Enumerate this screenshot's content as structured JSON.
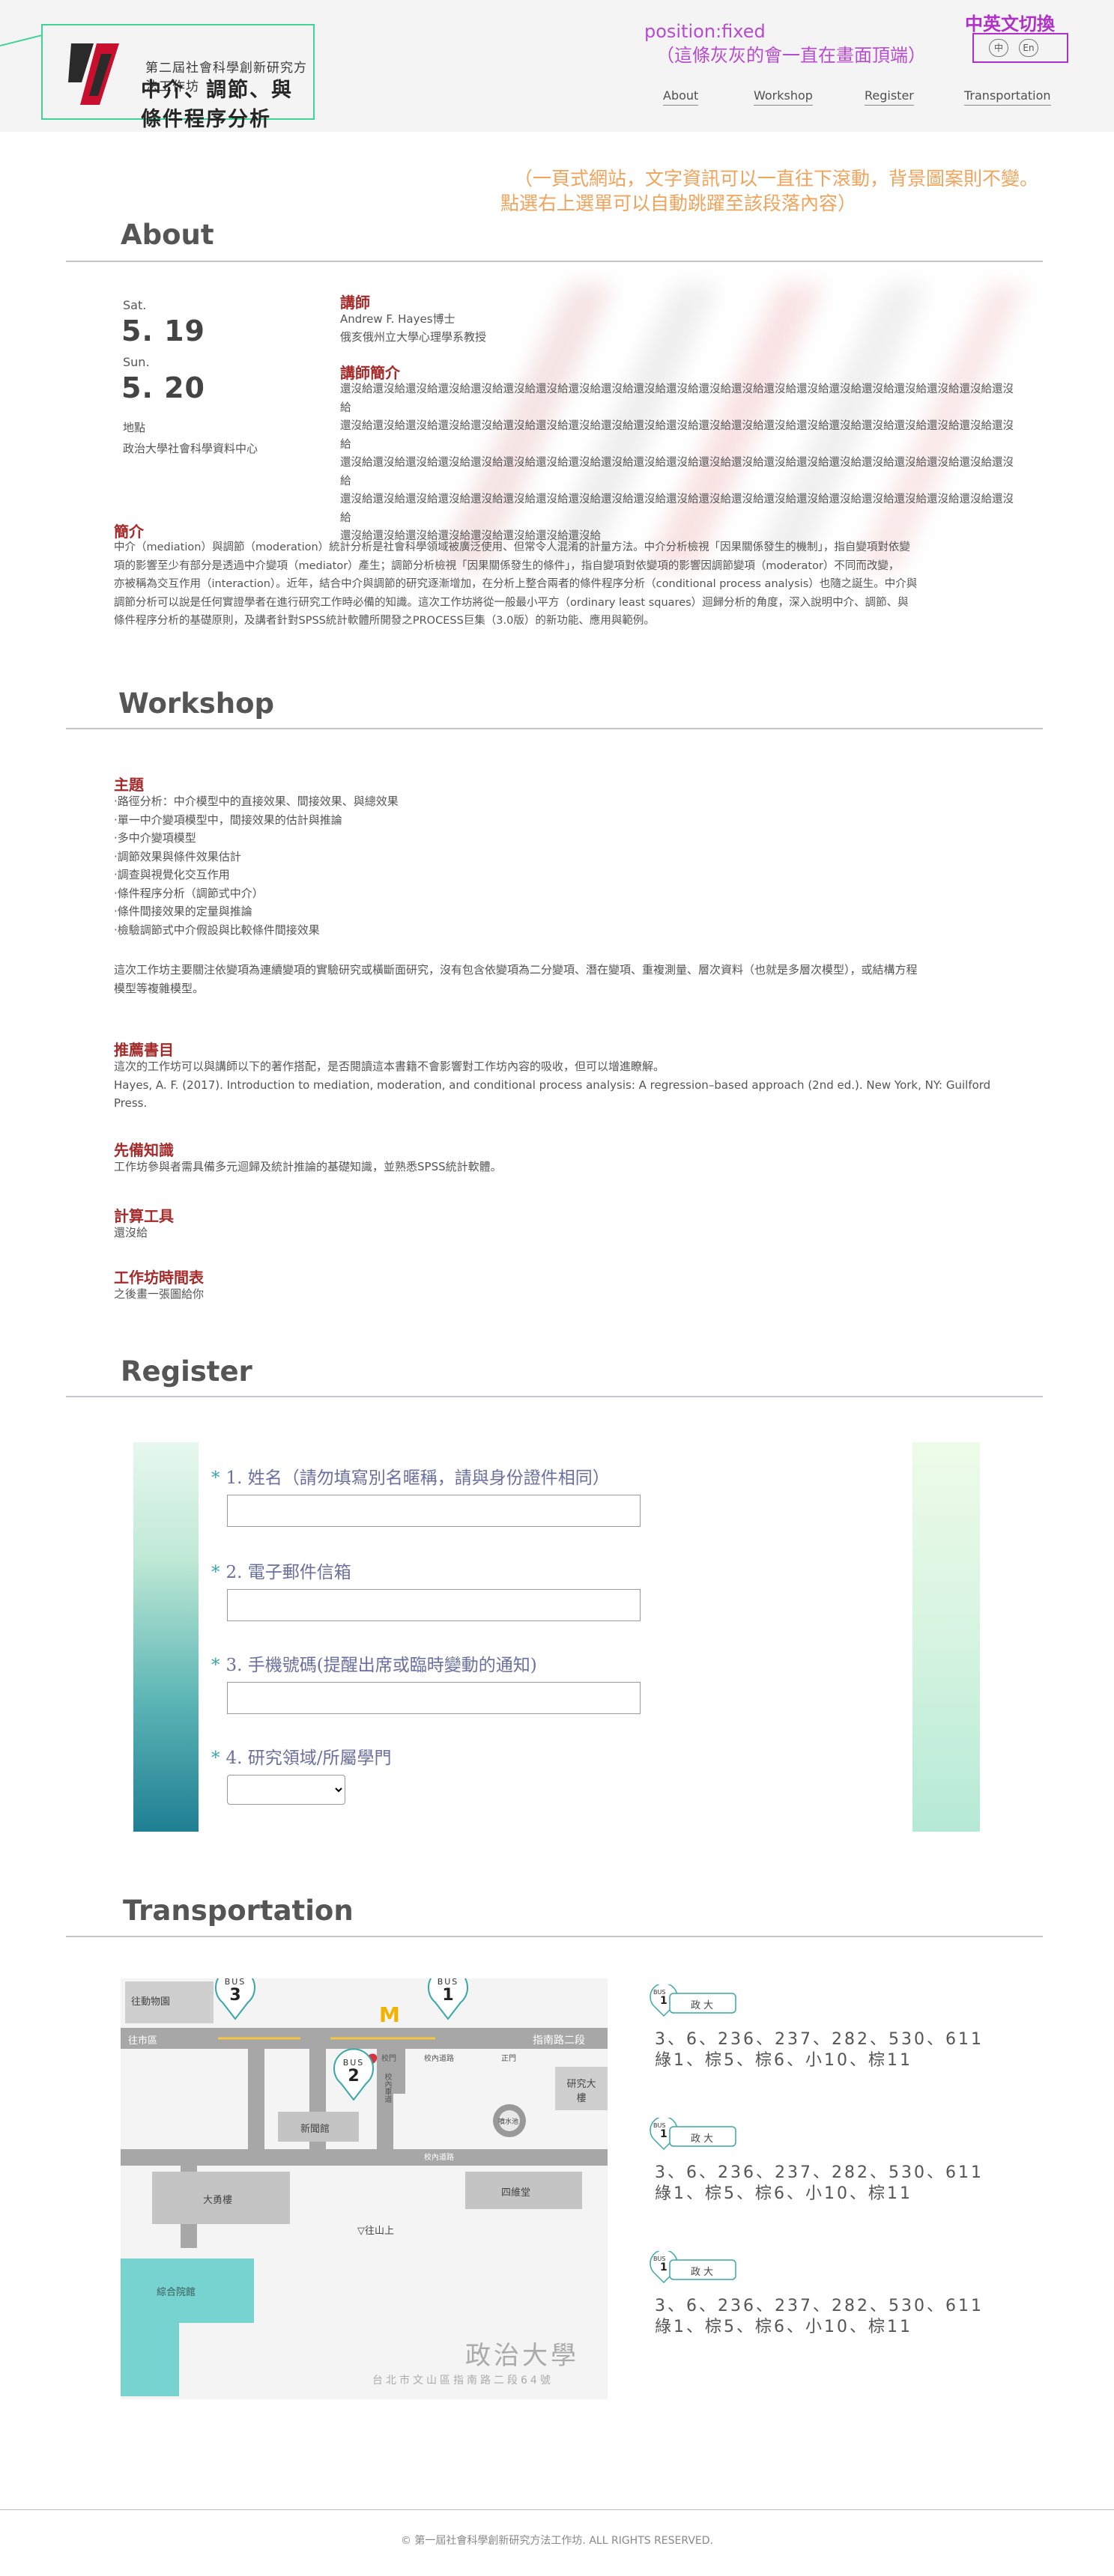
{
  "header": {
    "subtitle": "第二屆社會科學創新研究方法工作坊",
    "title": "中介、調節、與條件程序分析",
    "annotation_line1": "position:fixed",
    "annotation_line2": "（這條灰灰的會一直在畫面頂端）",
    "lang_title": "中英文切換",
    "lang_zh": "中",
    "lang_en": "En",
    "nav": [
      "About",
      "Workshop",
      "Register",
      "Transportation"
    ]
  },
  "annotation_scroll": {
    "line1": "（一頁式網站，文字資訊可以一直往下滾動，背景圖案則不變。",
    "line2": "點選右上選單可以自動跳躍至該段落內容）"
  },
  "about": {
    "title": "About",
    "day1_label": "Sat.",
    "day1_date": "5. 19",
    "day2_label": "Sun.",
    "day2_date": "5. 20",
    "venue_label": "地點",
    "venue": "政治大學社會科學資料中心",
    "lecturer_heading": "講師",
    "lecturer_name": "Andrew F. Hayes博士",
    "lecturer_affil": "俄亥俄州立大學心理學系教授",
    "bio_heading": "講師簡介",
    "bio_lines": [
      "還沒給還沒給還沒給還沒給還沒給還沒給還沒給還沒給還沒給還沒給還沒給還沒給還沒給還沒給還沒給還沒給還沒給還沒給還沒給還沒給還沒給",
      "還沒給還沒給還沒給還沒給還沒給還沒給還沒給還沒給還沒給還沒給還沒給還沒給還沒給還沒給還沒給還沒給還沒給還沒給還沒給還沒給還沒給",
      "還沒給還沒給還沒給還沒給還沒給還沒給還沒給還沒給還沒給還沒給還沒給還沒給還沒給還沒給還沒給還沒給還沒給還沒給還沒給還沒給還沒給",
      "還沒給還沒給還沒給還沒給還沒給還沒給還沒給還沒給還沒給還沒給還沒給還沒給還沒給還沒給還沒給還沒給還沒給還沒給還沒給還沒給還沒給",
      "還沒給還沒給還沒給還沒給還沒給還沒給還沒給還沒給"
    ],
    "intro_heading": "簡介",
    "intro_lines": [
      "中介（mediation）與調節（moderation）統計分析是社會科學領域被廣泛使用、但常令人混淆的計量方法。中介分析檢視「因果關係發生的機制」，指自變項對依變",
      "項的影響至少有部分是透過中介變項（mediator）產生；調節分析檢視「因果關係發生的條件」，指自變項對依變項的影響因調節變項（moderator）不同而改變，",
      "亦被稱為交互作用（interaction）。近年，結合中介與調節的研究逐漸增加，在分析上整合兩者的條件程序分析（conditional process analysis）也隨之誕生。中介與",
      "調節分析可以說是任何實證學者在進行研究工作時必備的知識。這次工作坊將從一般最小平方（ordinary least squares）迴歸分析的角度，深入說明中介、調節、與",
      "條件程序分析的基礎原則，及講者針對SPSS統計軟體所開發之PROCESS巨集（3.0版）的新功能、應用與範例。"
    ]
  },
  "workshop": {
    "title": "Workshop",
    "topic_heading": "主題",
    "topics": [
      "‧路徑分析：中介模型中的直接效果、間接效果、與總效果",
      "‧單一中介變項模型中，間接效果的估計與推論",
      "‧多中介變項模型",
      "‧調節效果與條件效果估計",
      "‧調查與視覺化交互作用",
      "‧條件程序分析（調節式中介）",
      "‧條件間接效果的定量與推論",
      "‧檢驗調節式中介假設與比較條件間接效果"
    ],
    "note_lines": [
      "這次工作坊主要關注依變項為連續變項的實驗研究或橫斷面研究，沒有包含依變項為二分變項、潛在變項、重複測量、層次資料（也就是多層次模型），或結構方程",
      "模型等複雜模型。"
    ],
    "books_heading": "推薦書目",
    "books_lines": [
      "這次的工作坊可以與講師以下的著作搭配，是否閱讀這本書籍不會影響對工作坊內容的吸收，但可以增進瞭解。",
      "Hayes, A. F. (2017). Introduction to mediation, moderation, and conditional process analysis: A regression–based approach (2nd ed.). New York, NY: Guilford",
      "Press."
    ],
    "prereq_heading": "先備知識",
    "prereq_text": "工作坊參與者需具備多元迴歸及統計推論的基礎知識，並熟悉SPSS統計軟體。",
    "tools_heading": "計算工具",
    "tools_text": "還沒給",
    "schedule_heading": "工作坊時間表",
    "schedule_text": "之後畫一張圖給你"
  },
  "register": {
    "title": "Register",
    "q1": "1. 姓名（請勿填寫別名暱稱，請與身份證件相同）",
    "q2": "2. 電子郵件信箱",
    "q3": "3. 手機號碼(提醒出席或臨時變動的通知)",
    "q4": "4. 研究領域/所屬學門",
    "required_mark": "*",
    "q1_value": "",
    "q2_value": "",
    "q3_value": "",
    "q4_selected": ""
  },
  "transportation": {
    "title": "Transportation",
    "map": {
      "zoo": "往動物園",
      "city": "往市區",
      "zhinan": "指南路二段",
      "bus": "BUS",
      "bus3": "3",
      "bus1": "1",
      "bus2": "2",
      "gate": "校門",
      "gate2": "正門",
      "inner_road": "校內道路",
      "inner_road2": "校內道路",
      "research": "研究大樓",
      "xinwen": "新聞館",
      "dayong": "大勇樓",
      "siwei": "四維堂",
      "zonghe": "綜合院館",
      "fountain": "噴水池",
      "xinghe": "校內車道",
      "to_uphill": "▽往山上",
      "school_name": "政治大學",
      "address": "台北市文山區指南路二段64號"
    },
    "routes": [
      {
        "bus": "BUS",
        "num": "1",
        "stop": "政大",
        "line1": "3、6、236、237、282、530、611",
        "line2": "綠1、棕5、棕6、小10、棕11"
      },
      {
        "bus": "BUS",
        "num": "1",
        "stop": "政大",
        "line1": "3、6、236、237、282、530、611",
        "line2": "綠1、棕5、棕6、小10、棕11"
      },
      {
        "bus": "BUS",
        "num": "1",
        "stop": "政大",
        "line1": "3、6、236、237、282、530、611",
        "line2": "綠1、棕5、棕6、小10、棕11"
      }
    ]
  },
  "footer": {
    "text": "© 第一屆社會科學創新研究方法工作坊. ALL RIGHTS RESERVED."
  },
  "colors": {
    "accent_red": "#a52a2a",
    "teal": "#3aa7a7",
    "annotation_purple": "#b030c8",
    "annotation_orange": "#f0a35b",
    "map_teal": "#76d3cf"
  }
}
